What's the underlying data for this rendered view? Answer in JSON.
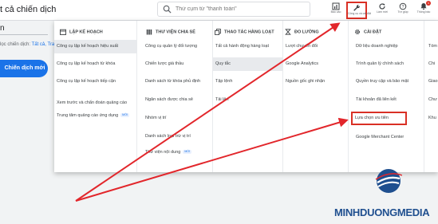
{
  "header": {
    "page_title": "t cả chiến dịch",
    "search_placeholder": "Thử cụm từ \"thanh toán\"",
    "tools": [
      {
        "label": "Báo cáo",
        "icon": "reports-icon"
      },
      {
        "label": "Công cụ và cài đặt",
        "icon": "wrench-icon"
      },
      {
        "label": "Làm mới",
        "icon": "refresh-icon"
      },
      {
        "label": "Trợ giúp",
        "icon": "help-icon"
      },
      {
        "label": "Thông báo",
        "icon": "bell-icon",
        "badge": "1"
      }
    ]
  },
  "left": {
    "field_text": "n",
    "filter_prefix": "lọc chiến dịch: ",
    "filter_value": "Tất cả, Trang",
    "new_campaign_button": "Chiến dịch mới"
  },
  "menu": {
    "columns": [
      {
        "heading": "LẬP KẾ HOẠCH",
        "icon": "calendar-icon",
        "items": [
          {
            "label": "Công cụ lập kế hoạch hiệu suất",
            "selected": true
          },
          {
            "label": "Công cụ lập kế hoạch từ khóa"
          },
          {
            "label": "Công cụ lập kế hoạch tiếp cận"
          },
          {
            "label": "Xem trước và chẩn đoán quảng cáo"
          },
          {
            "label": "Trung tâm quảng cáo ứng dụng",
            "badge": "MỚI"
          }
        ]
      },
      {
        "heading": "THƯ VIỆN CHIA SẺ",
        "icon": "library-icon",
        "items": [
          {
            "label": "Công cụ quản lý đối tượng"
          },
          {
            "label": "Chiến lược giá thầu"
          },
          {
            "label": "Danh sách từ khóa phủ định"
          },
          {
            "label": "Ngân sách được chia sẻ"
          },
          {
            "label": "Nhóm vị trí"
          },
          {
            "label": "Danh sách loại trừ vị trí"
          },
          {
            "label": "Thư viện nội dung",
            "badge": "MỚI"
          }
        ]
      },
      {
        "heading": "THAO TÁC HÀNG LOẠT",
        "icon": "copy-icon",
        "items": [
          {
            "label": "Tất cả hành động hàng loạt"
          },
          {
            "label": "Quy tắc",
            "selected": true
          },
          {
            "label": "Tập lệnh"
          },
          {
            "label": "Tải lên"
          }
        ]
      },
      {
        "heading": "ĐO LƯỜNG",
        "icon": "hourglass-icon",
        "items": [
          {
            "label": "Lượt chuyển đổi"
          },
          {
            "label": "Google Analytics"
          },
          {
            "label": "Nguồn gốc ghi nhận"
          }
        ]
      },
      {
        "heading": "CÀI ĐẶT",
        "icon": "settings-icon",
        "items": [
          {
            "label": "Dữ liệu doanh nghiệp"
          },
          {
            "label": "Trình quản lý chính sách"
          },
          {
            "label": "Quyền truy cập và bảo mật"
          },
          {
            "label": "Tài khoản đã liên kết"
          },
          {
            "label": "Lựa chọn ưu tiên",
            "highlighted": true
          },
          {
            "label": "Google Merchant Center"
          }
        ]
      },
      {
        "heading": "",
        "icon": "",
        "items": [
          {
            "label": "Tóm"
          },
          {
            "label": "Chi"
          },
          {
            "label": "Giao"
          },
          {
            "label": "Chư"
          },
          {
            "label": "Khu"
          }
        ]
      }
    ]
  },
  "brand": {
    "name": "MINHDUONGMEDIA",
    "logo_icon": "globe-swoosh-logo"
  },
  "colors": {
    "accent": "#1a73e8",
    "highlight_box": "#d93025",
    "annotation_arrow": "#e2262b",
    "brand": "#1f4f8f"
  }
}
